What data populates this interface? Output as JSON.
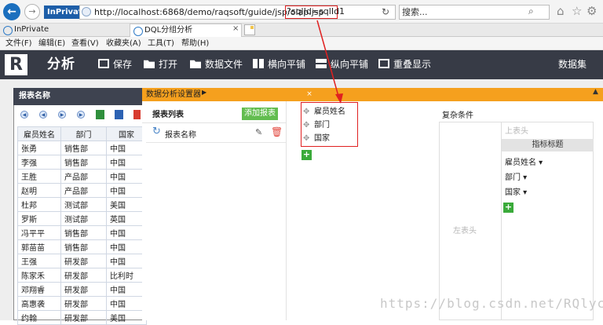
{
  "browser": {
    "inprivate": "InPrivate",
    "url_prefix": "http://localhost:6868/demo/raqsoft/guide/jsp/olap.jsp",
    "url_query": "?sqlId=sqlId1",
    "search_placeholder": "搜索..."
  },
  "tabs": [
    {
      "label": "InPrivate"
    },
    {
      "label": "DQL分组分析"
    }
  ],
  "menu": [
    "文件(F)",
    "编辑(E)",
    "查看(V)",
    "收藏夹(A)",
    "工具(T)",
    "帮助(H)"
  ],
  "app": {
    "logo": "R",
    "title": "分析",
    "toolbar": [
      "保存",
      "打开",
      "数据文件",
      "横向平铺",
      "纵向平铺",
      "重叠显示"
    ],
    "dataset": "数据集"
  },
  "report": {
    "title": "报表名称",
    "columns": [
      "雇员姓名",
      "部门",
      "国家"
    ],
    "rows": [
      [
        "张勇",
        "销售部",
        "中国"
      ],
      [
        "李强",
        "销售部",
        "中国"
      ],
      [
        "王胜",
        "产品部",
        "中国"
      ],
      [
        "赵明",
        "产品部",
        "中国"
      ],
      [
        "杜邦",
        "测试部",
        "美国"
      ],
      [
        "罗斯",
        "测试部",
        "英国"
      ],
      [
        "冯平平",
        "销售部",
        "中国"
      ],
      [
        "郭苗苗",
        "销售部",
        "中国"
      ],
      [
        "王强",
        "研发部",
        "中国"
      ],
      [
        "陈家禾",
        "研发部",
        "比利时"
      ],
      [
        "邓翔睿",
        "研发部",
        "中国"
      ],
      [
        "高惠袭",
        "研发部",
        "中国"
      ],
      [
        "约翰",
        "研发部",
        "美国"
      ]
    ]
  },
  "settings": {
    "title": "数据分析设置器",
    "close": "×",
    "list_title": "报表列表",
    "add_report": "添加报表",
    "report_item": "报表名称",
    "fields": [
      "雇员姓名",
      "部门",
      "国家"
    ],
    "conditions_label": "复杂条件",
    "upper_header": "上表头",
    "metric_title": "指标标题",
    "condition_fields": [
      "雇员姓名 ▾",
      "部门 ▾",
      "国家 ▾"
    ],
    "left_header": "左表头"
  },
  "watermark": "https://blog.csdn.net/RQlyc"
}
